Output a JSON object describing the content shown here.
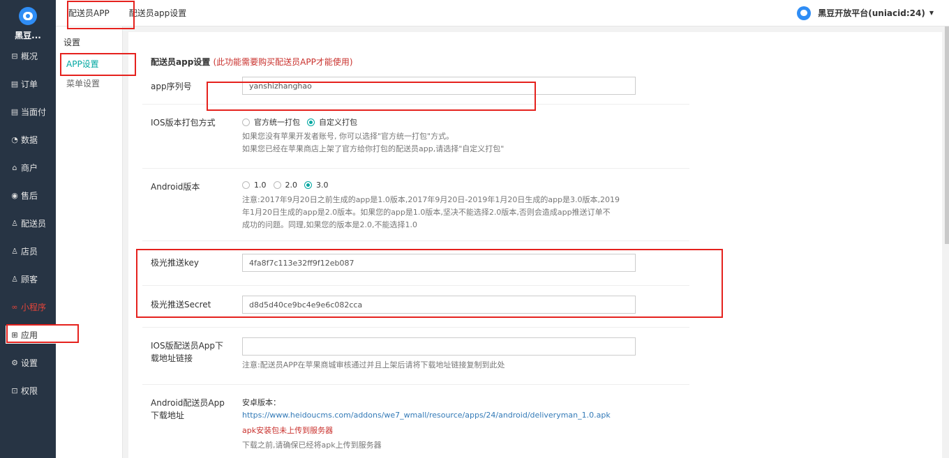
{
  "brand": "黑豆...",
  "nav": [
    {
      "icon": "⊟",
      "label": "概况"
    },
    {
      "icon": "▤",
      "label": "订单"
    },
    {
      "icon": "▤",
      "label": "当面付"
    },
    {
      "icon": "◔",
      "label": "数据"
    },
    {
      "icon": "⌂",
      "label": "商户"
    },
    {
      "icon": "◉",
      "label": "售后"
    },
    {
      "icon": "♙",
      "label": "配送员"
    },
    {
      "icon": "♙",
      "label": "店员"
    },
    {
      "icon": "♙",
      "label": "顾客"
    },
    {
      "icon": "∞",
      "label": "小程序"
    },
    {
      "icon": "⊞",
      "label": "应用"
    },
    {
      "icon": "⚙",
      "label": "设置"
    },
    {
      "icon": "⊡",
      "label": "权限"
    }
  ],
  "topbar": {
    "tab1": "配送员APP",
    "tab2": "配送员app设置",
    "account": "黑豆开放平台(uniacid:24)"
  },
  "subnav": {
    "title": "设置",
    "items": [
      "APP设置",
      "菜单设置"
    ]
  },
  "form": {
    "title": "配送员app设置",
    "title_note": "(此功能需要购买配送员APP才能使用)",
    "serial": {
      "label": "app序列号",
      "value": "yanshizhanghao"
    },
    "ios_pack": {
      "label": "IOS版本打包方式",
      "options": [
        "官方统一打包",
        "自定义打包"
      ],
      "selected": "自定义打包",
      "help1": "如果您没有苹果开发者账号, 你可以选择\"官方统一打包\"方式。",
      "help2": "如果您已经在苹果商店上架了官方给你打包的配送员app,请选择\"自定义打包\""
    },
    "android": {
      "label": "Android版本",
      "options": [
        "1.0",
        "2.0",
        "3.0"
      ],
      "selected": "3.0",
      "help1": "注意:2017年9月20日之前生成的app是1.0版本,2017年9月20日-2019年1月20日生成的app是3.0版本,2019",
      "help2": "年1月20日生成的app是2.0版本。如果您的app是1.0版本,坚决不能选择2.0版本,否则会造成app推送订单不",
      "help3": "成功的问题。同理,如果您的版本是2.0,不能选择1.0"
    },
    "jpush_key": {
      "label": "极光推送key",
      "value": "4fa8f7c113e32ff9f12eb087"
    },
    "jpush_secret": {
      "label": "极光推送Secret",
      "value": "d8d5d40ce9bc4e9e6c082cca"
    },
    "ios_link": {
      "label1": "IOS版配送员App下",
      "label2": "载地址链接",
      "value": "",
      "help": "注意:配送员APP在苹果商城审核通过并且上架后请将下载地址链接复制到此处"
    },
    "android_link": {
      "label1": "Android配送员App",
      "label2": "下载地址",
      "heading": "安卓版本：",
      "url": "https://www.heidoucms.com/addons/we7_wmall/resource/apps/24/android/deliveryman_1.0.apk",
      "warn": "apk安装包未上传到服务器",
      "help": "下载之前,请确保已经将apk上传到服务器"
    }
  },
  "colors": {
    "accent": "#00a7a1",
    "sidebar": "#273444",
    "annotation": "#e5211d",
    "warn": "#c9302c"
  }
}
